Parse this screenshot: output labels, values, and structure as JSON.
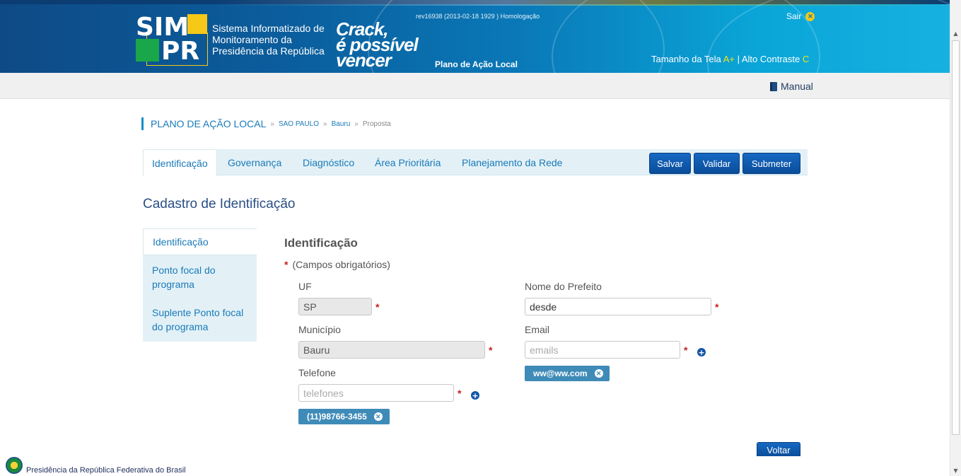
{
  "header": {
    "logo_sim": "SIM",
    "logo_pr": "PR",
    "system_name": "Sistema Informatizado de Monitoramento da Presidência da República",
    "campaign_line1": "Crack,",
    "campaign_line2": "é possível",
    "campaign_line3": "vencer",
    "module_title": "Plano de Ação Local",
    "revision": "rev16938 (2013-02-18 1929 ) Homologação",
    "logout_label": "Sair",
    "screen_size_label": "Tamanho da Tela",
    "screen_size_value": "A+",
    "separator": "|",
    "contrast_label": "Alto Contraste",
    "contrast_value": "C",
    "colors": {
      "brand_blue": "#0b5d9c",
      "brand_yellow": "#f6c817",
      "brand_green": "#1aa64a"
    }
  },
  "toolbar": {
    "manual_label": "Manual",
    "manual_icon": "book-icon"
  },
  "breadcrumb": {
    "root": "PLANO DE AÇÃO LOCAL",
    "sep": "»",
    "state": "SAO PAULO",
    "city": "Bauru",
    "current": "Proposta"
  },
  "tabs": [
    {
      "label": "Identificação",
      "active": true
    },
    {
      "label": "Governança"
    },
    {
      "label": "Diagnóstico"
    },
    {
      "label": "Área Prioritária"
    },
    {
      "label": "Planejamento da Rede"
    }
  ],
  "actions": {
    "save": "Salvar",
    "validate": "Validar",
    "submit": "Submeter",
    "back": "Voltar"
  },
  "page_title": "Cadastro de Identificação",
  "sidenav": [
    {
      "label": "Identificação",
      "active": true
    },
    {
      "label": "Ponto focal do programa"
    },
    {
      "label": "Suplente Ponto focal do programa"
    }
  ],
  "form": {
    "title": "Identificação",
    "required_mark": "*",
    "required_note": "(Campos obrigatórios)",
    "uf": {
      "label": "UF",
      "value": "SP"
    },
    "municipio": {
      "label": "Município",
      "value": "Bauru"
    },
    "telefone": {
      "label": "Telefone",
      "placeholder": "telefones",
      "tags": [
        "(11)98766-3455"
      ]
    },
    "prefeito": {
      "label": "Nome do Prefeito",
      "value": "desde"
    },
    "email": {
      "label": "Email",
      "placeholder": "emails",
      "tags": [
        "ww@ww.com"
      ]
    }
  },
  "footer": {
    "text": "Presidência da República Federativa do Brasil"
  }
}
